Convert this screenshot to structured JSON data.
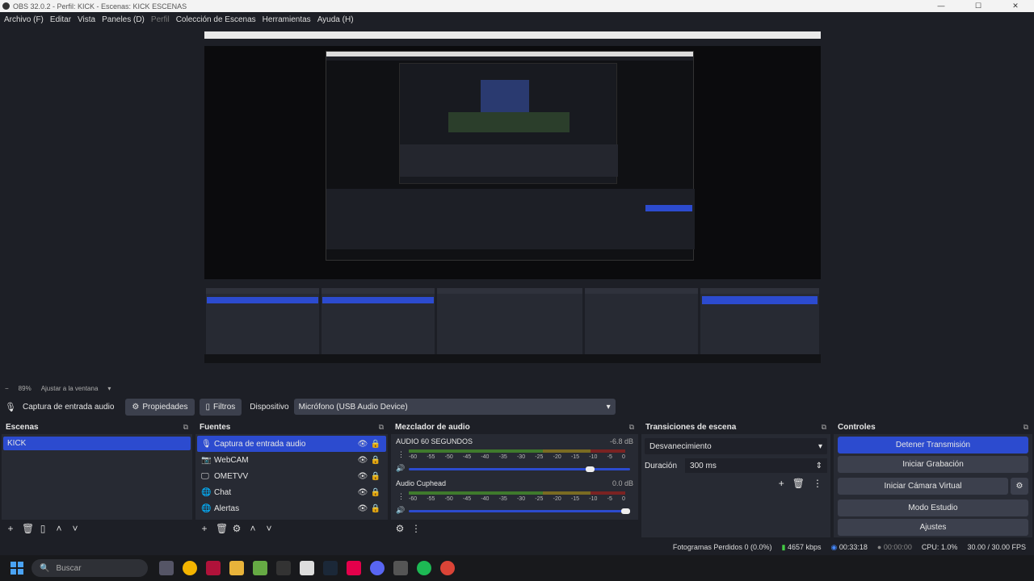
{
  "window": {
    "title": "OBS 32.0.2 - Perfil: KICK - Escenas: KICK ESCENAS",
    "minimize": "—",
    "maximize": "☐",
    "close": "✕"
  },
  "menu": [
    "Archivo (F)",
    "Editar",
    "Vista",
    "Paneles (D)",
    "Perfil",
    "Colección de Escenas",
    "Herramientas",
    "Ayuda (H)"
  ],
  "zoom": {
    "minus": "−",
    "value": "89%",
    "fit": "Ajustar a la ventana"
  },
  "source_bar": {
    "source_name": "Captura de entrada audio",
    "properties": "Propiedades",
    "filters": "Filtros",
    "device_label": "Dispositivo",
    "device_value": "Micrófono (USB Audio Device)"
  },
  "scenes": {
    "title": "Escenas",
    "items": [
      "KICK"
    ]
  },
  "sources": {
    "title": "Fuentes",
    "items": [
      {
        "name": "Captura de entrada audio",
        "icon": "mic-icon",
        "glyph": "🎙"
      },
      {
        "name": "WebCAM",
        "icon": "camera-icon",
        "glyph": "📷"
      },
      {
        "name": "OMETVV",
        "icon": "monitor-icon",
        "glyph": "🖵"
      },
      {
        "name": "Chat",
        "icon": "browser-icon",
        "glyph": "🌐"
      },
      {
        "name": "Alertas",
        "icon": "browser-icon",
        "glyph": "🌐"
      }
    ]
  },
  "mixer": {
    "title": "Mezclador de audio",
    "ticks": [
      "-60",
      "-55",
      "-50",
      "-45",
      "-40",
      "-35",
      "-30",
      "-25",
      "-20",
      "-15",
      "-10",
      "-5",
      "0"
    ],
    "channels": [
      {
        "name": "AUDIO 60 SEGUNDOS",
        "db": "-6.8 dB",
        "volume": 0.84
      },
      {
        "name": "Audio Cuphead",
        "db": "0.0 dB",
        "volume": 1.0
      }
    ]
  },
  "transitions": {
    "title": "Transiciones de escena",
    "selected": "Desvanecimiento",
    "duration_label": "Duración",
    "duration_value": "300 ms"
  },
  "controls": {
    "title": "Controles",
    "stop_stream": "Detener Transmisión",
    "start_recording": "Iniciar Grabación",
    "virtual_cam": "Iniciar Cámara Virtual",
    "studio_mode": "Modo Estudio",
    "settings": "Ajustes"
  },
  "status": {
    "dropped": "Fotogramas Perdidos 0 (0.0%)",
    "bitrate": "4657 kbps",
    "stream_time": "00:33:18",
    "rec_time": "00:00:00",
    "cpu": "CPU: 1.0%",
    "fps": "30.00 / 30.00 FPS"
  },
  "taskbar": {
    "search_placeholder": "Buscar"
  },
  "colors": {
    "accent": "#2c4bcf",
    "panel": "#272a33",
    "bg": "#1d1f26"
  }
}
